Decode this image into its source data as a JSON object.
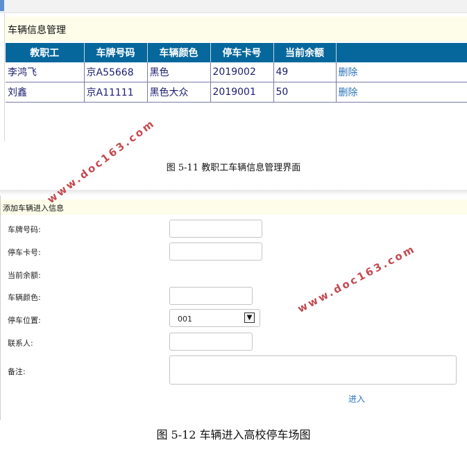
{
  "screen1": {
    "title": "车辆信息管理",
    "columns": [
      "教职工",
      "车牌号码",
      "车辆颜色",
      "停车卡号",
      "当前余额",
      ""
    ],
    "rows": [
      {
        "name": "李鸿飞",
        "plate": "京A55668",
        "color": "黑色",
        "card": "2019002",
        "balance": "49",
        "action": "删除"
      },
      {
        "name": "刘鑫",
        "plate": "京A11111",
        "color": "黑色大众",
        "card": "2019001",
        "balance": "50",
        "action": "删除"
      }
    ]
  },
  "caption1": "图 5-11 教职工车辆信息管理界面",
  "screen2": {
    "title": "添加车辆进入信息",
    "labels": {
      "plate": "车牌号码:",
      "card": "停车卡号:",
      "balance": "当前余额:",
      "color": "车辆颜色:",
      "position": "停车位置:",
      "contact": "联系人:",
      "remark": "备注:"
    },
    "position_value": "001",
    "submit_label": "进入"
  },
  "caption2": "图 5-12 车辆进入高校停车场图",
  "watermark": "www.doc163.com",
  "colors": {
    "header_bg": "#06679c",
    "link": "#2a74b9",
    "watermark": "#c44a50",
    "title_bar_bg": "#fdfdea"
  }
}
